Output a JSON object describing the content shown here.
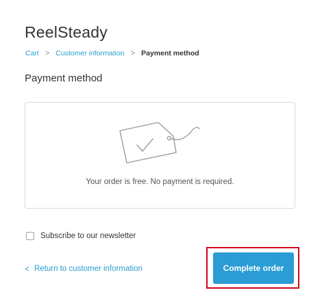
{
  "store": {
    "name": "ReelSteady"
  },
  "breadcrumb": {
    "items": [
      {
        "label": "Cart"
      },
      {
        "label": "Customer information"
      },
      {
        "label": "Payment method"
      }
    ],
    "separator": ">"
  },
  "payment": {
    "title": "Payment method",
    "icon": "price-tag-check-icon",
    "free_message": "Your order is free. No payment is required."
  },
  "newsletter": {
    "label": "Subscribe to our newsletter",
    "checked": false
  },
  "navigation": {
    "return_label": "Return to customer information",
    "return_chevron": "<",
    "complete_label": "Complete order"
  },
  "colors": {
    "link": "#2a9dcc",
    "button": "#2b9cd5",
    "highlight": "#d0021b",
    "text": "#333333"
  }
}
